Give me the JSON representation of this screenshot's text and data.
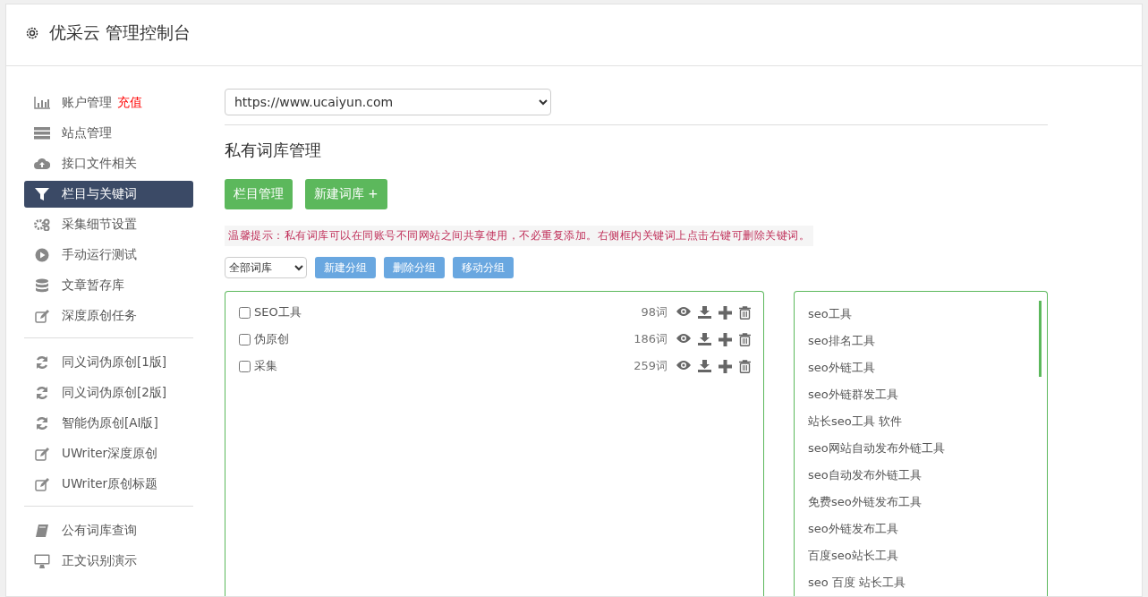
{
  "header": {
    "title": "优采云 管理控制台"
  },
  "sidebar": {
    "groups": [
      [
        {
          "label": "账户管理",
          "badge": "充值",
          "selected": false
        },
        {
          "label": "站点管理",
          "selected": false
        },
        {
          "label": "接口文件相关",
          "selected": false
        },
        {
          "label": "栏目与关键词",
          "selected": true
        },
        {
          "label": "采集细节设置",
          "selected": false
        },
        {
          "label": "手动运行测试",
          "selected": false
        },
        {
          "label": "文章暂存库",
          "selected": false
        },
        {
          "label": "深度原创任务",
          "selected": false
        }
      ],
      [
        {
          "label": "同义词伪原创[1版]",
          "selected": false
        },
        {
          "label": "同义词伪原创[2版]",
          "selected": false
        },
        {
          "label": "智能伪原创[AI版]",
          "selected": false
        },
        {
          "label": "UWriter深度原创",
          "selected": false
        },
        {
          "label": "UWriter原创标题",
          "selected": false
        }
      ],
      [
        {
          "label": "公有词库查询",
          "selected": false
        },
        {
          "label": "正文识别演示",
          "selected": false
        }
      ]
    ]
  },
  "site_select": {
    "value": "https://www.ucaiyun.com"
  },
  "heading": "私有词库管理",
  "action_buttons": [
    "栏目管理",
    "新建词库 +"
  ],
  "notice": "温馨提示：私有词库可以在同账号不同网站之间共享使用，不必重复添加。右侧框内关键词上点击右键可删除关键词。",
  "filter_select": {
    "value": "全部词库"
  },
  "group_buttons": [
    "新建分组",
    "删除分组",
    "移动分组"
  ],
  "libraries": [
    {
      "name": "SEO工具",
      "count": "98词",
      "checked": false
    },
    {
      "name": "伪原创",
      "count": "186词",
      "checked": false
    },
    {
      "name": "采集",
      "count": "259词",
      "checked": false
    }
  ],
  "keywords": [
    "seo工具",
    "seo排名工具",
    "seo外链工具",
    "seo外链群发工具",
    "站长seo工具 软件",
    "seo网站自动发布外链工具",
    "seo自动发布外链工具",
    "免费seo外链发布工具",
    "seo外链发布工具",
    "百度seo站长工具",
    "seo 百度 站长工具"
  ]
}
